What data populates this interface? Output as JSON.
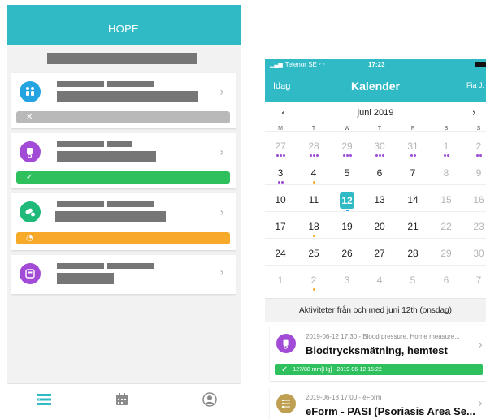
{
  "left_app": {
    "header_title": "HOPE",
    "colors": {
      "header": "#2fbac6",
      "grey_bar": "#b9b9b9",
      "green_bar": "#2fc05e",
      "orange_bar": "#f7a92a"
    },
    "cards": [
      {
        "icon": "people-icon",
        "icon_color": "#23a3e0",
        "status": "cancelled",
        "status_glyph": "✕",
        "has_bar": true
      },
      {
        "icon": "blood-pressure-icon",
        "icon_color": "#a24bd6",
        "status": "completed",
        "status_glyph": "✓",
        "has_bar": true
      },
      {
        "icon": "pills-icon",
        "icon_color": "#1fb97a",
        "status": "pending",
        "status_glyph": "◔",
        "has_bar": true
      },
      {
        "icon": "scale-icon",
        "icon_color": "#a24bd6",
        "status": "none",
        "status_glyph": "",
        "has_bar": false
      }
    ],
    "tabs": [
      {
        "icon": "list-icon",
        "active": true
      },
      {
        "icon": "calendar-icon",
        "active": false
      },
      {
        "icon": "profile-icon",
        "active": false
      }
    ]
  },
  "right_app": {
    "status_bar": {
      "carrier": "Telenor SE",
      "time": "17:23"
    },
    "nav": {
      "left": "Idag",
      "title": "Kalender",
      "right": "Fia J."
    },
    "month_label": "juni 2019",
    "weekdays": [
      "M",
      "T",
      "W",
      "T",
      "F",
      "S",
      "S"
    ],
    "weeks": [
      [
        {
          "d": "27",
          "m": false,
          "dots": [
            "#9b4bd6",
            "#9b4bd6",
            "#9b4bd6"
          ]
        },
        {
          "d": "28",
          "m": false,
          "dots": [
            "#9b4bd6",
            "#9b4bd6",
            "#9b4bd6"
          ]
        },
        {
          "d": "29",
          "m": false,
          "dots": [
            "#9b4bd6",
            "#9b4bd6",
            "#9b4bd6"
          ]
        },
        {
          "d": "30",
          "m": false,
          "dots": [
            "#9b4bd6",
            "#9b4bd6",
            "#9b4bd6"
          ]
        },
        {
          "d": "31",
          "m": false,
          "dots": [
            "#9b4bd6",
            "#9b4bd6"
          ]
        },
        {
          "d": "1",
          "m": false,
          "dots": [
            "#9b4bd6",
            "#9b4bd6"
          ]
        },
        {
          "d": "2",
          "m": false,
          "dots": [
            "#9b4bd6",
            "#9b4bd6"
          ]
        }
      ],
      [
        {
          "d": "3",
          "m": true,
          "dots": [
            "#9b4bd6",
            "#9b4bd6"
          ]
        },
        {
          "d": "4",
          "m": true,
          "dots": [
            "#f7a92a"
          ]
        },
        {
          "d": "5",
          "m": true,
          "dots": []
        },
        {
          "d": "6",
          "m": true,
          "dots": []
        },
        {
          "d": "7",
          "m": true,
          "dots": []
        },
        {
          "d": "8",
          "m": false,
          "dots": []
        },
        {
          "d": "9",
          "m": false,
          "dots": []
        }
      ],
      [
        {
          "d": "10",
          "m": true,
          "dots": []
        },
        {
          "d": "11",
          "m": true,
          "dots": []
        },
        {
          "d": "12",
          "m": true,
          "dots": [
            "#23a3e0"
          ],
          "sel": true
        },
        {
          "d": "13",
          "m": true,
          "dots": []
        },
        {
          "d": "14",
          "m": true,
          "dots": []
        },
        {
          "d": "15",
          "m": false,
          "dots": []
        },
        {
          "d": "16",
          "m": false,
          "dots": []
        }
      ],
      [
        {
          "d": "17",
          "m": true,
          "dots": []
        },
        {
          "d": "18",
          "m": true,
          "dots": [
            "#f7a92a"
          ]
        },
        {
          "d": "19",
          "m": true,
          "dots": []
        },
        {
          "d": "20",
          "m": true,
          "dots": []
        },
        {
          "d": "21",
          "m": true,
          "dots": []
        },
        {
          "d": "22",
          "m": false,
          "dots": []
        },
        {
          "d": "23",
          "m": false,
          "dots": []
        }
      ],
      [
        {
          "d": "24",
          "m": true,
          "dots": []
        },
        {
          "d": "25",
          "m": true,
          "dots": []
        },
        {
          "d": "26",
          "m": true,
          "dots": []
        },
        {
          "d": "27",
          "m": true,
          "dots": []
        },
        {
          "d": "28",
          "m": true,
          "dots": []
        },
        {
          "d": "29",
          "m": false,
          "dots": []
        },
        {
          "d": "30",
          "m": false,
          "dots": []
        }
      ],
      [
        {
          "d": "1",
          "m": false,
          "dots": []
        },
        {
          "d": "2",
          "m": false,
          "dots": [
            "#f7a92a"
          ]
        },
        {
          "d": "3",
          "m": false,
          "dots": []
        },
        {
          "d": "4",
          "m": false,
          "dots": []
        },
        {
          "d": "5",
          "m": false,
          "dots": []
        },
        {
          "d": "6",
          "m": false,
          "dots": []
        },
        {
          "d": "7",
          "m": false,
          "dots": []
        }
      ]
    ],
    "activities_header": "Aktiviteter från och med juni 12th (onsdag)",
    "activities": [
      {
        "icon": "blood-pressure-icon",
        "icon_color": "#a24bd6",
        "meta": "2019-06-12 17:30 - Blood pressure, Home measure...",
        "title": "Blodtrycksmätning, hemtest",
        "result": "127/88 mm[Hg] - 2019-06-12 15:22"
      },
      {
        "icon": "eform-icon",
        "icon_color": "#bfa052",
        "meta": "2019-06-18 17:00 - eForm",
        "title": "eForm - PASI (Psoriasis Area Se...",
        "result": ""
      }
    ]
  }
}
